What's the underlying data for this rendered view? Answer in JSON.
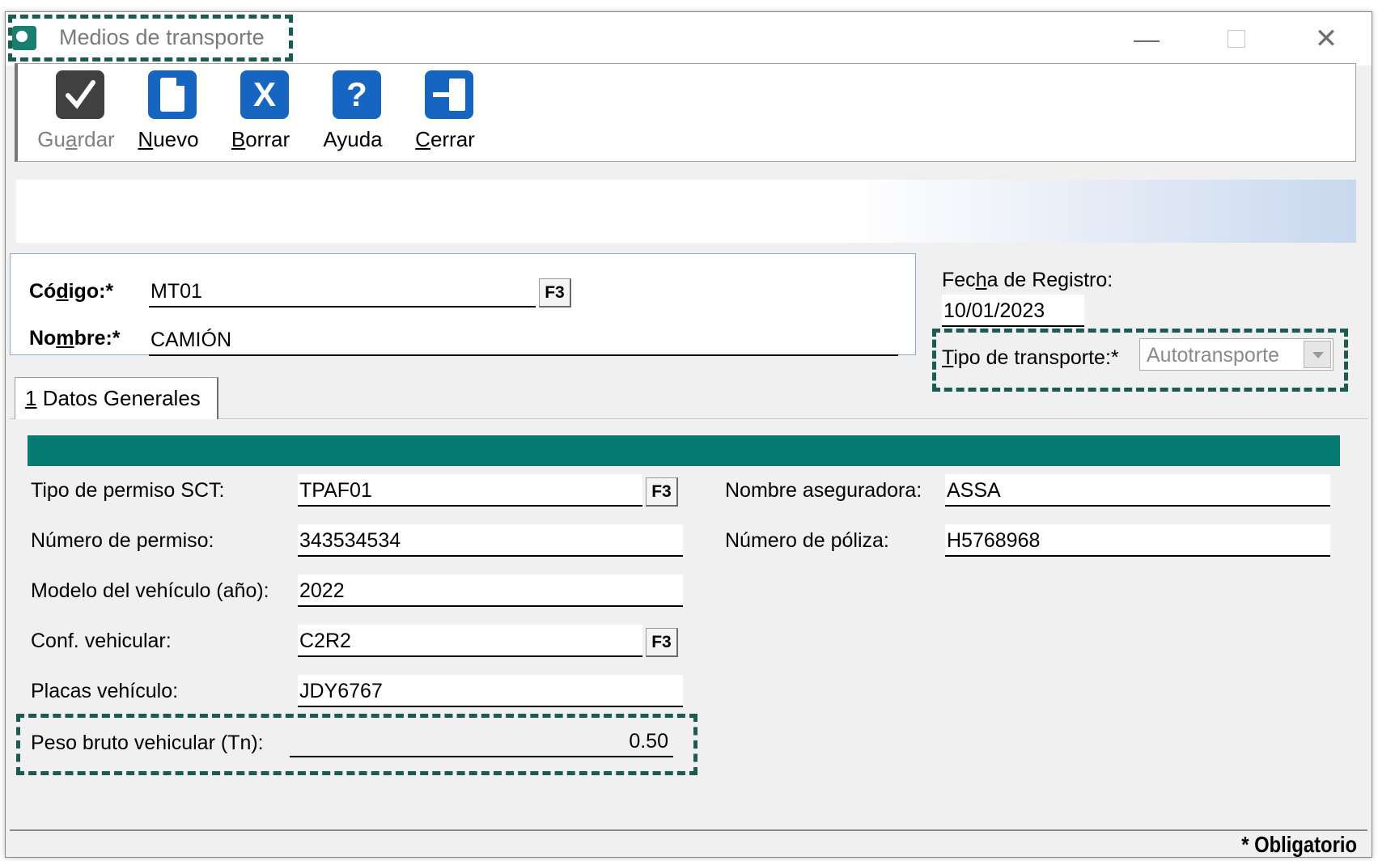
{
  "window": {
    "title": "Medios de transporte",
    "controls": {
      "minimize": "—",
      "close": "✕"
    }
  },
  "toolbar": {
    "save": {
      "pre": "Gu",
      "accel": "a",
      "post": "rdar",
      "icon": "checkmark-icon",
      "enabled": false
    },
    "new": {
      "pre": "",
      "accel": "N",
      "post": "uevo",
      "icon": "new-document-icon"
    },
    "delete": {
      "pre": "",
      "accel": "B",
      "post": "orrar",
      "icon": "delete-x-icon",
      "glyph": "X"
    },
    "help": {
      "label": "Ayuda",
      "icon": "help-icon",
      "glyph": "?"
    },
    "close": {
      "pre": "",
      "accel": "C",
      "post": "errar",
      "icon": "exit-door-icon"
    }
  },
  "header": {
    "codigo": {
      "pre": "Có",
      "accel": "d",
      "post": "igo:*",
      "value": "MT01",
      "lookup": "F3"
    },
    "nombre": {
      "pre": "No",
      "accel": "m",
      "post": "bre:*",
      "value": "CAMIÓN"
    },
    "fecha": {
      "pre": "Fec",
      "accel": "h",
      "post": "a de Registro:",
      "value": "10/01/2023"
    },
    "tipo_transporte": {
      "accel": "T",
      "post": "ipo de transporte:*",
      "value": "Autotransporte"
    }
  },
  "tabs": [
    {
      "accel": "1",
      "post": " Datos Generales"
    }
  ],
  "fields_left": {
    "tipo_permiso": {
      "label": "Tipo de permiso SCT:",
      "value": "TPAF01",
      "lookup": "F3"
    },
    "numero_permiso": {
      "label": "Número de permiso:",
      "value": "343534534"
    },
    "modelo": {
      "label": "Modelo del vehículo (año):",
      "value": "2022"
    },
    "conf_vehicular": {
      "label": "Conf. vehicular:",
      "value": "C2R2",
      "lookup": "F3"
    },
    "placas": {
      "label": "Placas vehículo:",
      "value": "JDY6767"
    },
    "peso_bruto": {
      "label": "Peso bruto vehicular (Tn):",
      "value": "0.50"
    }
  },
  "fields_right": {
    "aseguradora": {
      "label": "Nombre aseguradora:",
      "value": "ASSA"
    },
    "poliza": {
      "label": "Número de póliza:",
      "value": "H5768968"
    }
  },
  "footer": {
    "required_note": "* Obligatorio"
  },
  "colors": {
    "accent_teal": "#047a70",
    "icon_blue": "#1665c1",
    "highlight_dash": "#1d5a52"
  }
}
